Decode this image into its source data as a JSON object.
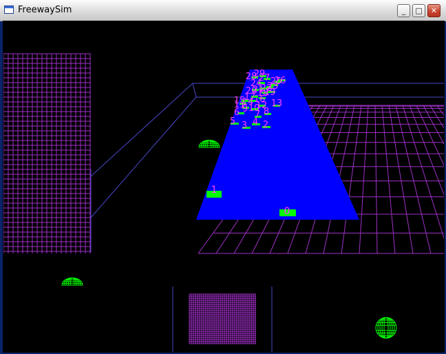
{
  "window": {
    "title": "FreewaySim",
    "app_icon": "window-icon"
  },
  "caption_buttons": [
    {
      "name": "minimize-button",
      "icon": "minimize-icon",
      "glyph": "_"
    },
    {
      "name": "maximize-button",
      "icon": "maximize-icon",
      "glyph": "□"
    },
    {
      "name": "close-button",
      "icon": "close-icon",
      "glyph": "✕"
    }
  ],
  "colors": {
    "background": "#000000",
    "road": "#0000ff",
    "grid": "#a030c8",
    "wire": "#4040c0",
    "car": "#00ff00",
    "label": "#ff40ff"
  },
  "vehicles": [
    "0",
    "1",
    "2",
    "3",
    "4",
    "5",
    "6",
    "7",
    "8",
    "9",
    "10",
    "11",
    "12",
    "13",
    "14",
    "15",
    "16",
    "17",
    "18",
    "19",
    "20",
    "21",
    "22",
    "23",
    "24",
    "25",
    "26",
    "27",
    "28",
    "29"
  ]
}
